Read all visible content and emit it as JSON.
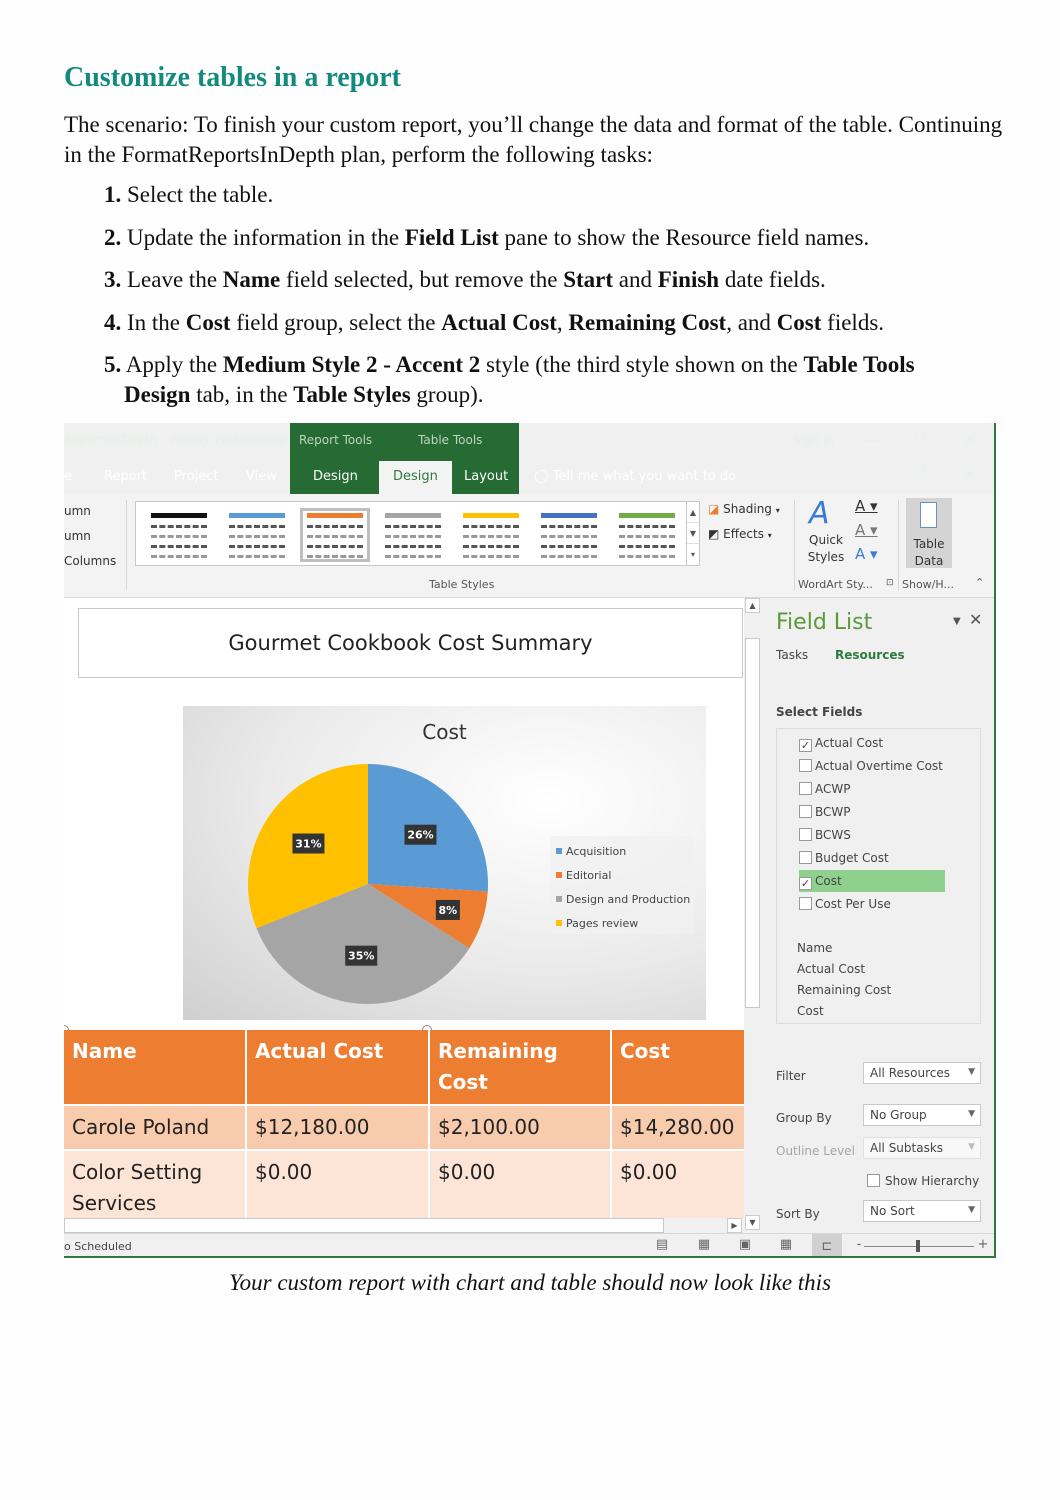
{
  "document": {
    "heading": "Customize tables in a report",
    "intro": "The scenario: To finish your custom report, you’ll change the data and format of the table. Continuing in the FormatReportsInDepth plan, perform the following tasks:",
    "steps": [
      {
        "num": "1.",
        "parts": [
          {
            "t": " Select the table.",
            "b": false
          }
        ]
      },
      {
        "num": "2.",
        "parts": [
          {
            "t": " Update the information in the ",
            "b": false
          },
          {
            "t": "Field List",
            "b": true
          },
          {
            "t": " pane to show the Resource field names.",
            "b": false
          }
        ]
      },
      {
        "num": "3.",
        "parts": [
          {
            "t": " Leave the ",
            "b": false
          },
          {
            "t": "Name",
            "b": true
          },
          {
            "t": " field selected, but remove the ",
            "b": false
          },
          {
            "t": "Start",
            "b": true
          },
          {
            "t": " and ",
            "b": false
          },
          {
            "t": "Finish",
            "b": true
          },
          {
            "t": " date fields.",
            "b": false
          }
        ]
      },
      {
        "num": "4.",
        "parts": [
          {
            "t": " In the ",
            "b": false
          },
          {
            "t": "Cost",
            "b": true
          },
          {
            "t": " field group, select the ",
            "b": false
          },
          {
            "t": "Actual Cost",
            "b": true
          },
          {
            "t": ", ",
            "b": false
          },
          {
            "t": "Remaining Cost",
            "b": true
          },
          {
            "t": ", and ",
            "b": false
          },
          {
            "t": "Cost",
            "b": true
          },
          {
            "t": " fields.",
            "b": false
          }
        ]
      },
      {
        "num": "5.",
        "parts": [
          {
            "t": " Apply the ",
            "b": false
          },
          {
            "t": "Medium Style 2 - Accent 2",
            "b": true
          },
          {
            "t": " style (the third style shown on the ",
            "b": false
          },
          {
            "t": "Table Tools Design",
            "b": true
          },
          {
            "t": " tab, in the ",
            "b": false
          },
          {
            "t": "Table Styles",
            "b": true
          },
          {
            "t": " group).",
            "b": false
          }
        ]
      }
    ],
    "caption": "Your custom report with chart and table should now look like this"
  },
  "app": {
    "window_title": "ReportsInDepth - Project Professional",
    "context_report_tools": "Report Tools",
    "context_table_tools": "Table Tools",
    "sign_in": "Sign in",
    "minimize": "—",
    "restore": "❐",
    "close": "✕",
    "tabs": [
      {
        "label": "e",
        "active": false
      },
      {
        "label": "Report",
        "active": false
      },
      {
        "label": "Project",
        "active": false
      },
      {
        "label": "View",
        "active": false
      },
      {
        "label": "Design",
        "active": false
      },
      {
        "label": "Design",
        "active": true
      },
      {
        "label": "Layout",
        "active": false
      }
    ],
    "tell_me": "Tell me what you want to do",
    "ribbon": {
      "left_options": [
        "umn",
        "umn",
        "Columns"
      ],
      "table_styles_label": "Table Styles",
      "style_colors": [
        "#111111",
        "#5b9bd5",
        "#ed7d31",
        "#a5a5a5",
        "#ffc000",
        "#4472c4",
        "#70ad47"
      ],
      "selected_style_index": 2,
      "shading": "Shading",
      "effects": "Effects",
      "quick_styles": "Quick Styles",
      "wordart_label": "WordArt Sty...",
      "table_data": "Table Data",
      "show_hide_label": "Show/H..."
    },
    "report": {
      "title": "Gourmet Cookbook Cost Summary",
      "table": {
        "headers": [
          "Name",
          "Actual Cost",
          "Remaining Cost",
          "Cost"
        ],
        "rows": [
          [
            "Carole Poland",
            "$12,180.00",
            "$2,100.00",
            "$14,280.00"
          ],
          [
            "Color Setting Services",
            "$0.00",
            "$0.00",
            "$0.00"
          ]
        ]
      }
    },
    "field_list": {
      "title": "Field List",
      "tabs": [
        "Tasks",
        "Resources"
      ],
      "active_tab": "Resources",
      "select_fields_label": "Select Fields",
      "fields": [
        {
          "label": "Actual Cost",
          "checked": true,
          "highlighted": false
        },
        {
          "label": "Actual Overtime Cost",
          "checked": false,
          "highlighted": false
        },
        {
          "label": "ACWP",
          "checked": false,
          "highlighted": false
        },
        {
          "label": "BCWP",
          "checked": false,
          "highlighted": false
        },
        {
          "label": "BCWS",
          "checked": false,
          "highlighted": false
        },
        {
          "label": "Budget Cost",
          "checked": false,
          "highlighted": false
        },
        {
          "label": "Cost",
          "checked": true,
          "highlighted": true
        },
        {
          "label": "Cost Per Use",
          "checked": false,
          "highlighted": false
        }
      ],
      "selected_fields": [
        "Name",
        "Actual Cost",
        "Remaining Cost",
        "Cost"
      ],
      "filter_label": "Filter",
      "filter_value": "All Resources",
      "group_by_label": "Group By",
      "group_by_value": "No Group",
      "outline_level_label": "Outline Level",
      "outline_level_value": "All Subtasks",
      "show_hierarchy_label": "Show Hierarchy",
      "sort_by_label": "Sort By",
      "sort_by_value": "No Sort"
    },
    "status": {
      "text": "o Scheduled",
      "zoom_minus": "-",
      "zoom_plus": "+"
    }
  },
  "chart_data": {
    "type": "pie",
    "title": "Cost",
    "categories": [
      "Acquisition",
      "Editorial",
      "Design and Production",
      "Pages review"
    ],
    "values": [
      26,
      8,
      35,
      31
    ],
    "labels": [
      "26%",
      "8%",
      "35%",
      "31%"
    ],
    "colors": [
      "#5b9bd5",
      "#ed7d31",
      "#a5a5a5",
      "#ffc000"
    ],
    "legend_position": "right"
  }
}
